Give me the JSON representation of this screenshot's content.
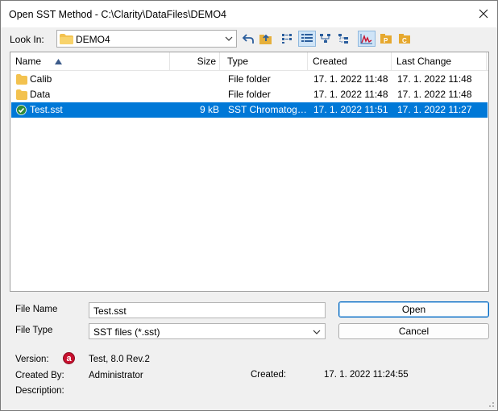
{
  "window": {
    "title": "Open SST Method - C:\\Clarity\\DataFiles\\DEMO4",
    "close_icon": "close-icon"
  },
  "lookin": {
    "label": "Look In:",
    "value": "DEMO4"
  },
  "toolbar": {
    "icons": [
      "back-arrow-icon",
      "up-folder-icon",
      "list-view-icon",
      "details-view-icon",
      "tree-view-icon",
      "tree-view-2-icon",
      "chromatogram-icon",
      "folder-p-icon",
      "folder-c-icon"
    ]
  },
  "list": {
    "columns": [
      "Name",
      "Size",
      "Type",
      "Created",
      "Last Change"
    ],
    "rows": [
      {
        "name": "Calib",
        "size": "",
        "type": "File folder",
        "created": "17. 1. 2022 11:48",
        "changed": "17. 1. 2022 11:48",
        "icon": "folder-icon"
      },
      {
        "name": "Data",
        "size": "",
        "type": "File folder",
        "created": "17. 1. 2022 11:48",
        "changed": "17. 1. 2022 11:48",
        "icon": "folder-icon"
      },
      {
        "name": "Test.sst",
        "size": "9 kB",
        "type": "SST Chromatog…",
        "created": "17. 1. 2022 11:51",
        "changed": "17. 1. 2022 11:27",
        "icon": "check-icon",
        "selected": true
      }
    ]
  },
  "form": {
    "file_name_label": "File Name",
    "file_name_value": "Test.sst",
    "file_type_label": "File Type",
    "file_type_value": "SST files (*.sst)",
    "open_label": "Open",
    "cancel_label": "Cancel"
  },
  "info": {
    "version_label": "Version:",
    "badge": "a",
    "version_value": "Test, 8.0 Rev.2",
    "created_by_label": "Created By:",
    "created_by_value": "Administrator",
    "created_label": "Created:",
    "created_value": "17. 1. 2022 11:24:55",
    "description_label": "Description:"
  },
  "colors": {
    "selection": "#0078d7",
    "folder": "#f3c24f",
    "badge": "#c8102e",
    "check": "#2e8b3a"
  }
}
